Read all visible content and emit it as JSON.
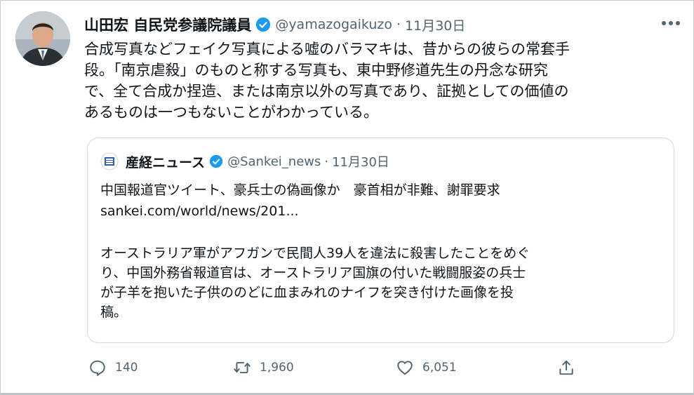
{
  "tweet": {
    "author_name": "山田宏 自民党参議院議員",
    "handle": "@yamazogaikuzo",
    "separator": "·",
    "date": "11月30日",
    "text": "合成写真などフェイク写真による嘘のバラマキは、昔からの彼らの常套手\n段。「南京虐殺」のものと称する写真も、東中野修道先生の丹念な研究\nで、全て合成か捏造、または南京以外の写真であり、証拠としての価値の\nあるものは一つもないことがわかっている。"
  },
  "quoted": {
    "author_name": "産経ニュース",
    "handle": "@Sankei_news",
    "separator": "·",
    "date": "11月30日",
    "headline": "中国報道官ツイート、豪兵士の偽画像か　豪首相が非難、謝罪要求",
    "link": "sankei.com/world/news/201...",
    "body": "オーストラリア軍がアフガンで民間人39人を違法に殺害したことをめぐ\nり、中国外務省報道官は、オーストラリア国旗の付いた戦闘服姿の兵士\nが子羊を抱いた子供ののどに血まみれのナイフを突き付けた画像を投\n稿。"
  },
  "actions": {
    "reply_count": "140",
    "retweet_count": "1,960",
    "like_count": "6,051"
  },
  "icons": {
    "verified": "verified-badge-icon",
    "more": "more-options-icon",
    "reply": "reply-icon",
    "retweet": "retweet-icon",
    "like": "heart-icon",
    "share": "share-icon"
  },
  "colors": {
    "verified": "#1d9bf0",
    "secondary_text": "#536471",
    "border": "#cfd9de"
  }
}
